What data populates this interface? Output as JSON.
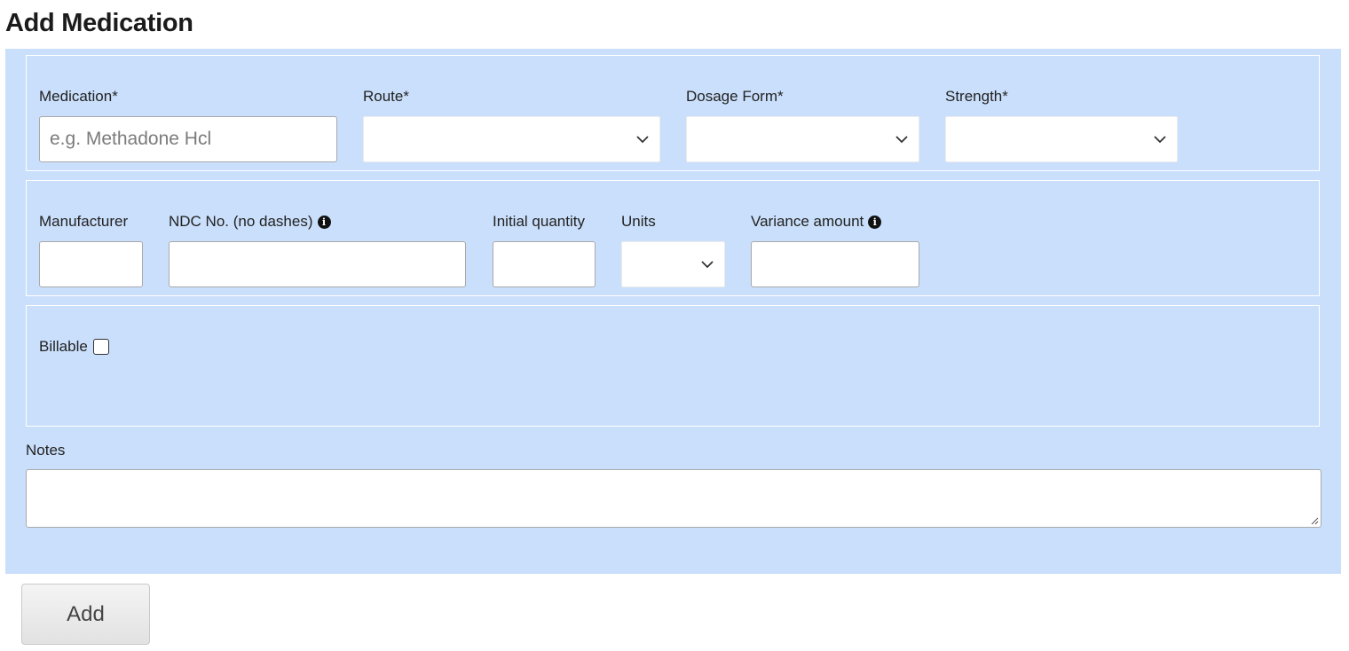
{
  "page": {
    "title": "Add Medication"
  },
  "row1": {
    "medication": {
      "label": "Medication*",
      "placeholder": "e.g. Methadone Hcl",
      "value": ""
    },
    "route": {
      "label": "Route*",
      "selected": ""
    },
    "dosage_form": {
      "label": "Dosage Form*",
      "selected": ""
    },
    "strength": {
      "label": "Strength*",
      "selected": ""
    }
  },
  "row2": {
    "manufacturer": {
      "label": "Manufacturer",
      "value": ""
    },
    "ndc": {
      "label": "NDC No. (no dashes)",
      "value": "",
      "icon": "info-circle-icon"
    },
    "initial_quantity": {
      "label": "Initial quantity",
      "value": ""
    },
    "units": {
      "label": "Units",
      "selected": ""
    },
    "variance": {
      "label": "Variance amount",
      "value": "",
      "icon": "info-circle-icon"
    }
  },
  "row3": {
    "billable": {
      "label": "Billable",
      "checked": false
    }
  },
  "notes": {
    "label": "Notes",
    "value": ""
  },
  "actions": {
    "add_label": "Add"
  },
  "colors": {
    "panel_bg": "#cadffb",
    "border": "#ffffff"
  }
}
